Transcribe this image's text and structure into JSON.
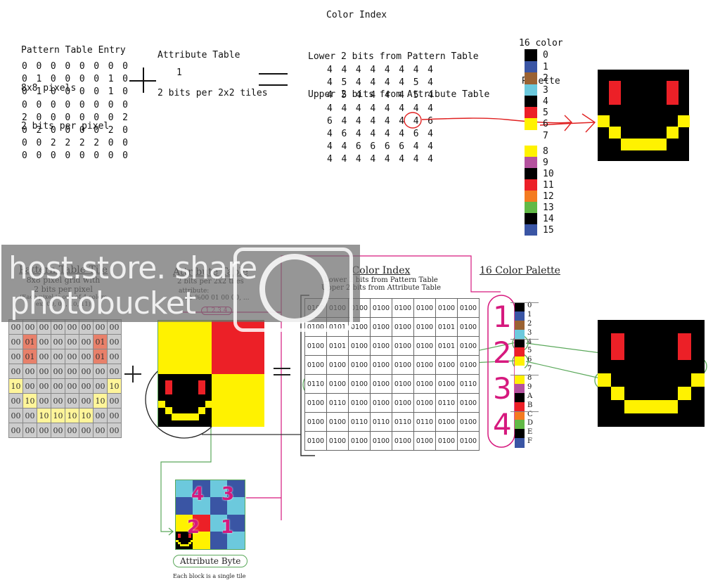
{
  "top": {
    "pattern": {
      "title_lines": [
        "Pattern Table Entry",
        "8x8 pixels",
        "2 bits per pixel"
      ],
      "rows": [
        "0 0 0 0 0 0 0 0",
        "0 1 0 0 0 0 1 0",
        "0 1 0 0 0 0 1 0",
        "0 0 0 0 0 0 0 0",
        "2 0 0 0 0 0 0 2",
        "0 2 0 0 0 0 2 0",
        "0 0 2 2 2 2 0 0",
        "0 0 0 0 0 0 0 0"
      ]
    },
    "plus_symbol": "+",
    "attribute": {
      "title_lines": [
        "Attribute Table",
        "2 bits per 2x2 tiles"
      ],
      "value": "1"
    },
    "equals_symbol": "=",
    "color_index": {
      "title": "Color Index",
      "subtitle_lines": [
        "Lower 2 bits from Pattern Table",
        "Upper 2 bits from Attribute Table"
      ],
      "rows": [
        "4 4 4 4 4 4 4 4",
        "4 5 4 4 4 4 5 4",
        "4 5 4 4 4 4 5 4",
        "4 4 4 4 4 4 4 4",
        "6 4 4 4 4 4 4 6",
        "4 6 4 4 4 4 6 4",
        "4 4 6 6 6 6 4 4",
        "4 4 4 4 4 4 4 4"
      ],
      "highlighted_value": "6"
    },
    "palette": {
      "title_lines": [
        "16 color",
        "Palette"
      ],
      "entries": [
        {
          "label": "0",
          "color": "#000000"
        },
        {
          "label": "1",
          "color": "#3a55a4"
        },
        {
          "label": "2",
          "color": "#9a6233"
        },
        {
          "label": "3",
          "color": "#6cc9dd"
        },
        {
          "label": "4",
          "color": "#000000"
        },
        {
          "label": "5",
          "color": "#ec2027"
        },
        {
          "label": "6",
          "color": "#fff200"
        },
        {
          "label": "7",
          "color": "#ffffff"
        },
        {
          "label": "8",
          "color": "#fff200"
        },
        {
          "label": "9",
          "color": "#b5529f"
        },
        {
          "label": "10",
          "color": "#000000"
        },
        {
          "label": "11",
          "color": "#ec2027"
        },
        {
          "label": "12",
          "color": "#f47b20"
        },
        {
          "label": "13",
          "color": "#62b946"
        },
        {
          "label": "14",
          "color": "#000000"
        },
        {
          "label": "15",
          "color": "#3a55a4"
        }
      ]
    }
  },
  "bottom": {
    "pattern_tile": {
      "title": "Pattern Table Tile",
      "subtitle_lines": [
        "8x8 pixel grid with",
        "2 bits per pixel"
      ],
      "note_lines": [
        "(Each pixel is one of 4 colors",
        "ex. 00, 01, 10, 11)"
      ],
      "rows": [
        [
          "00",
          "00",
          "00",
          "00",
          "00",
          "00",
          "00",
          "00"
        ],
        [
          "00",
          "01",
          "00",
          "00",
          "00",
          "00",
          "01",
          "00"
        ],
        [
          "00",
          "01",
          "00",
          "00",
          "00",
          "00",
          "01",
          "00"
        ],
        [
          "00",
          "00",
          "00",
          "00",
          "00",
          "00",
          "00",
          "00"
        ],
        [
          "10",
          "00",
          "00",
          "00",
          "00",
          "00",
          "00",
          "10"
        ],
        [
          "00",
          "10",
          "00",
          "00",
          "00",
          "00",
          "10",
          "00"
        ],
        [
          "00",
          "00",
          "10",
          "10",
          "10",
          "10",
          "00",
          "00"
        ],
        [
          "00",
          "00",
          "00",
          "00",
          "00",
          "00",
          "00",
          "00"
        ]
      ],
      "highlight_colors": {
        "01": "#e8806a",
        "10": "#fff59a"
      }
    },
    "plus_symbol": "+",
    "attribute_table": {
      "title": "Attribute Table",
      "subtitle": "2 bits per 2x2 tiles",
      "code_label": "attribute:",
      "code_line": ".db %00 01 00 00, ...",
      "code_markers": "1 2 3 4"
    },
    "equals_symbol": "=",
    "color_index": {
      "title": "Color Index",
      "subtitle_lines": [
        "Lower 2 bits from Pattern Table",
        "Upper 2 bits from Attribute Table"
      ],
      "rows": [
        [
          "0100",
          "0100",
          "0100",
          "0100",
          "0100",
          "0100",
          "0100",
          "0100"
        ],
        [
          "0100",
          "0101",
          "0100",
          "0100",
          "0100",
          "0100",
          "0101",
          "0100"
        ],
        [
          "0100",
          "0101",
          "0100",
          "0100",
          "0100",
          "0100",
          "0101",
          "0100"
        ],
        [
          "0100",
          "0100",
          "0100",
          "0100",
          "0100",
          "0100",
          "0100",
          "0100"
        ],
        [
          "0110",
          "0100",
          "0100",
          "0100",
          "0100",
          "0100",
          "0100",
          "0110"
        ],
        [
          "0100",
          "0110",
          "0100",
          "0100",
          "0100",
          "0100",
          "0110",
          "0100"
        ],
        [
          "0100",
          "0100",
          "0110",
          "0110",
          "0110",
          "0110",
          "0100",
          "0100"
        ],
        [
          "0100",
          "0100",
          "0100",
          "0100",
          "0100",
          "0100",
          "0100",
          "0100"
        ]
      ]
    },
    "palette": {
      "title": "16 Color Palette",
      "group_numbers": [
        "1",
        "2",
        "3",
        "4"
      ],
      "entries": [
        {
          "label": "0",
          "color": "#000000"
        },
        {
          "label": "1",
          "color": "#3a55a4"
        },
        {
          "label": "2",
          "color": "#9a6233"
        },
        {
          "label": "3",
          "color": "#6cc9dd"
        },
        {
          "label": "4",
          "color": "#000000"
        },
        {
          "label": "5",
          "color": "#ec2027"
        },
        {
          "label": "6",
          "color": "#fff200"
        },
        {
          "label": "7",
          "color": "#ffffff"
        },
        {
          "label": "8",
          "color": "#fff200"
        },
        {
          "label": "9",
          "color": "#b5529f"
        },
        {
          "label": "A",
          "color": "#000000"
        },
        {
          "label": "B",
          "color": "#ec2027"
        },
        {
          "label": "C",
          "color": "#f47b20"
        },
        {
          "label": "D",
          "color": "#62b946"
        },
        {
          "label": "E",
          "color": "#000000"
        },
        {
          "label": "F",
          "color": "#3a55a4"
        }
      ]
    },
    "attribute_byte": {
      "label": "Attribute Byte",
      "caption": "Each block is a single tile",
      "block_numbers": [
        "4",
        "3",
        "2",
        "1"
      ]
    }
  },
  "watermark": {
    "line1": "host.store. share",
    "line2": "photobucket"
  },
  "colors": {
    "black": "#000000",
    "red": "#ec2027",
    "yellow": "#fff200",
    "magenta": "#d6197e",
    "green": "#5aa85a",
    "annot_red": "#e02020"
  }
}
